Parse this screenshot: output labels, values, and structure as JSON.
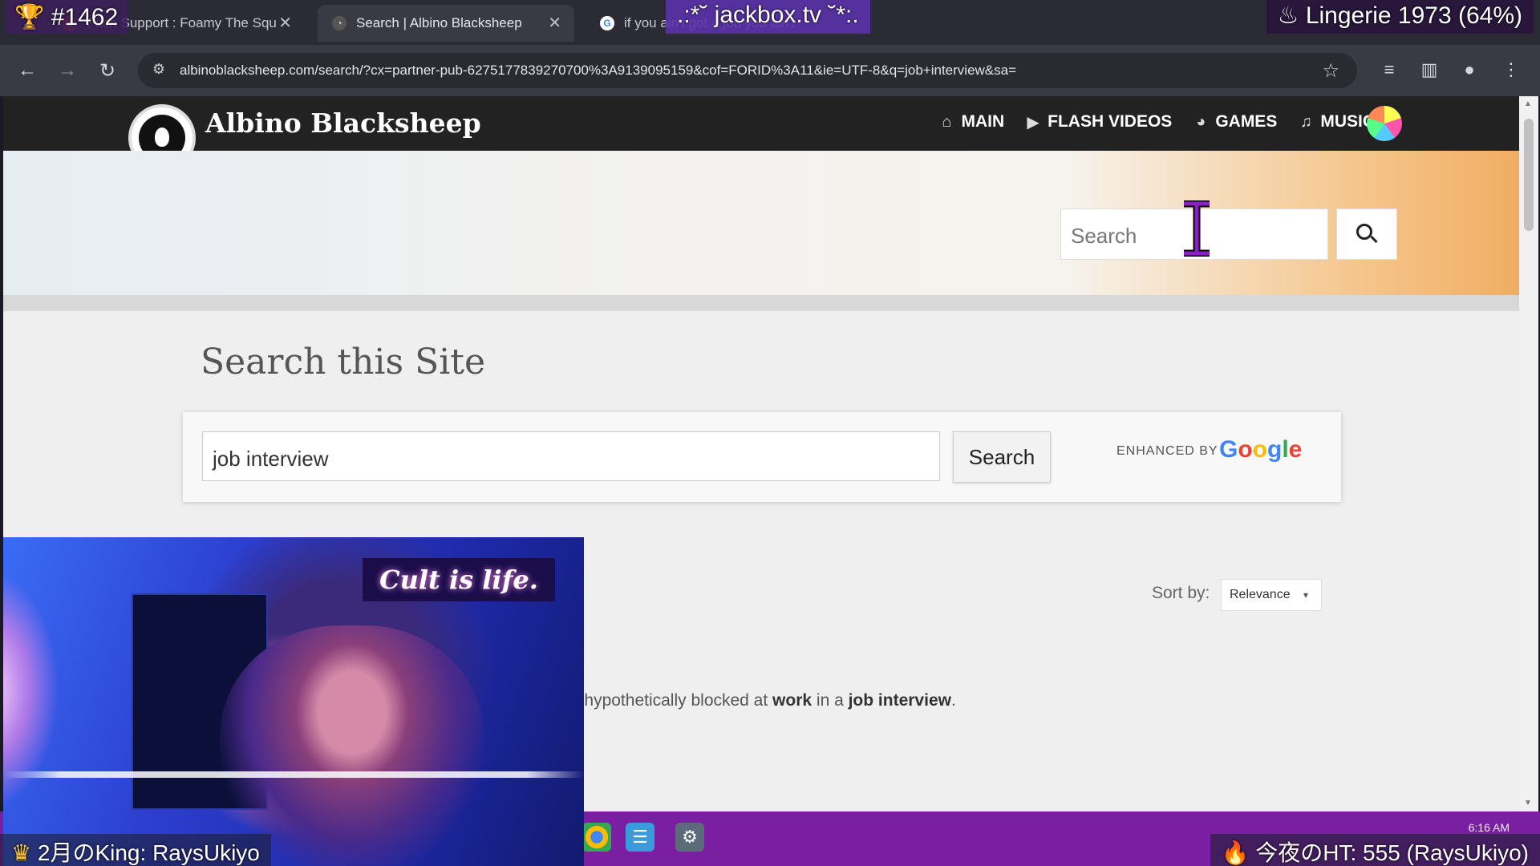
{
  "browser": {
    "tabs": [
      {
        "label": "Pitch Support : Foamy The Squ",
        "active": false
      },
      {
        "label": "Search | Albino Blacksheep",
        "active": true
      },
      {
        "label": "if you ain't got a job you ain't",
        "active": false
      }
    ],
    "url": "albinoblacksheep.com/search/?cx=partner-pub-6275177839270700%3A9139095159&cof=FORID%3A11&ie=UTF-8&q=job+interview&sa=",
    "icons": [
      "back-icon",
      "forward-icon",
      "reload-icon",
      "site-info-icon",
      "bookmark-star-icon",
      "media-queue-icon",
      "side-panel-icon",
      "profile-icon",
      "menu-icon"
    ]
  },
  "site": {
    "title": "Albino Blacksheep",
    "nav": [
      {
        "label": "MAIN",
        "icon": "home-icon"
      },
      {
        "label": "FLASH VIDEOS",
        "icon": "play-icon"
      },
      {
        "label": "GAMES",
        "icon": "pacman-icon"
      },
      {
        "label": "MUSIC",
        "icon": "music-note-icon"
      }
    ],
    "header_search_placeholder": "Search"
  },
  "main": {
    "heading": "Search this Site",
    "search_value": "job interview",
    "search_button": "Search",
    "enhanced_by": "ENHANCED BY",
    "google_letters": [
      "G",
      "o",
      "o",
      "g",
      "l",
      "e"
    ],
    "sort_label": "Sort by:",
    "sort_value": "Relevance",
    "result_snippet": {
      "pre": "eb sites are hypothetically blocked at ",
      "b1": "work",
      "mid": " in a ",
      "b2": "job interview",
      "post": "."
    }
  },
  "taskbar": {
    "time": "6:16 AM"
  },
  "overlays": {
    "trophy": "#1462",
    "center": ".:*˘ jackbox.tv ˘*:.",
    "now_playing": "Lingerie 1973 (64%)",
    "king": "2月のKing: RaysUkiyo",
    "ht": "今夜のHT: 555 (RaysUkiyo)",
    "webcam_sign": "Cult is life."
  },
  "colors": {
    "taskbar": "#7a1fa2",
    "site_header": "#222222",
    "accent_overlay": "#5a32aa"
  }
}
